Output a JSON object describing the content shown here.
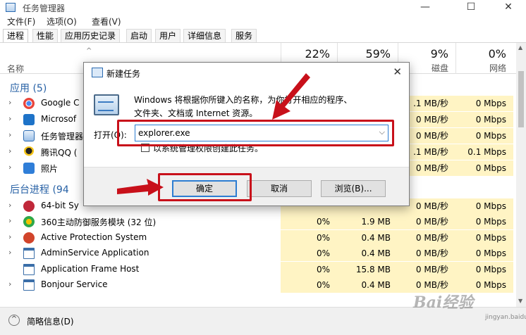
{
  "window": {
    "title": "任务管理器",
    "controls": {
      "minimize": "—",
      "maximize": "☐",
      "close": "✕"
    }
  },
  "menu": [
    "文件(F)",
    "选项(O)",
    "查看(V)"
  ],
  "tabs": [
    "进程",
    "性能",
    "应用历史记录",
    "启动",
    "用户",
    "详细信息",
    "服务"
  ],
  "columns": {
    "name": "名称",
    "cpu": {
      "pct": "22%",
      "label": ""
    },
    "memory": {
      "pct": "59%",
      "label": ""
    },
    "disk": {
      "pct": "9%",
      "label": "磁盘"
    },
    "network": {
      "pct": "0%",
      "label": "网络"
    }
  },
  "sections": {
    "apps": "应用 (5)",
    "background": "后台进程 (94"
  },
  "apps": [
    {
      "name": "Google C",
      "cpu": "",
      "mem": "",
      "disk": ".1 MB/秒",
      "net": "0 Mbps",
      "icon": "chrome-icon"
    },
    {
      "name": "Microsof",
      "cpu": "",
      "mem": "",
      "disk": "0 MB/秒",
      "net": "0 Mbps",
      "icon": "edge-icon"
    },
    {
      "name": "任务管理器",
      "cpu": "",
      "mem": "",
      "disk": "0 MB/秒",
      "net": "0 Mbps",
      "icon": "taskmgr-icon"
    },
    {
      "name": "腾讯QQ (",
      "cpu": "",
      "mem": "",
      "disk": ".1 MB/秒",
      "net": "0.1 Mbps",
      "icon": "qq-icon"
    },
    {
      "name": "照片",
      "cpu": "",
      "mem": "",
      "disk": "0 MB/秒",
      "net": "0 Mbps",
      "icon": "photos-icon"
    }
  ],
  "background": [
    {
      "name": "64-bit Sy",
      "cpu": "",
      "mem": "",
      "disk": "0 MB/秒",
      "net": "0 Mbps",
      "icon": "synaptics-icon"
    },
    {
      "name": "360主动防御服务模块 (32 位)",
      "cpu": "0%",
      "mem": "1.9 MB",
      "disk": "0 MB/秒",
      "net": "0 Mbps",
      "icon": "360-icon"
    },
    {
      "name": "Active Protection System",
      "cpu": "0%",
      "mem": "0.4 MB",
      "disk": "0 MB/秒",
      "net": "0 Mbps",
      "icon": "service-icon"
    },
    {
      "name": "AdminService Application",
      "cpu": "0%",
      "mem": "0.4 MB",
      "disk": "0 MB/秒",
      "net": "0 Mbps",
      "icon": "service-icon"
    },
    {
      "name": "Application Frame Host",
      "cpu": "0%",
      "mem": "15.8 MB",
      "disk": "0 MB/秒",
      "net": "0 Mbps",
      "icon": "service-icon"
    },
    {
      "name": "Bonjour Service",
      "cpu": "0%",
      "mem": "0.4 MB",
      "disk": "0 MB/秒",
      "net": "0 Mbps",
      "icon": "service-icon"
    }
  ],
  "footer": {
    "label": "简略信息(D)",
    "watermark": "Bai经验",
    "watermark_sub": "jingyan.baidu.com"
  },
  "dialog": {
    "title": "新建任务",
    "close": "✕",
    "desc_line1": "Windows 将根据你所键入的名称，为你打开相应的程序、",
    "desc_line2": "文件夹、文档或 Internet 资源。",
    "open_label": "打开(O):",
    "input_value": "explorer.exe",
    "checkbox_label": "以系统管理权限创建此任务。",
    "buttons": {
      "ok": "确定",
      "cancel": "取消",
      "browse": "浏览(B)..."
    }
  },
  "colors": {
    "accent": "#2d7dd2",
    "highlight": "#fff4c4",
    "annotation": "#c8101a",
    "section": "#2761a5"
  }
}
